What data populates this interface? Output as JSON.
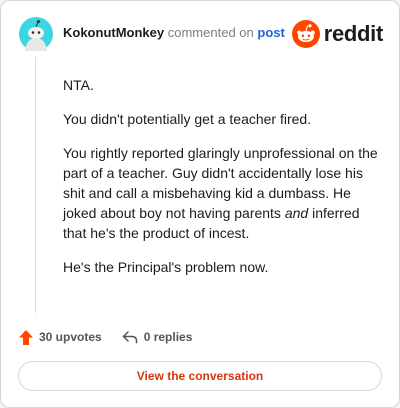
{
  "header": {
    "username": "KokonutMonkey",
    "action_text": "commented on",
    "post_link": "post",
    "logo_text": "reddit"
  },
  "comment": {
    "paragraphs": [
      "NTA.",
      "You didn't potentially get a teacher fired.",
      "You rightly reported glaringly unprofessional on the part of a teacher. Guy didn't accidentally lose his shit and call a misbehaving kid a dumbass. He joked about boy not having parents ",
      "He's the Principal's problem now."
    ],
    "p3_emphasis": "and",
    "p3_tail": " inferred that he's the product of incest."
  },
  "actions": {
    "upvotes": "30 upvotes",
    "replies": "0 replies"
  },
  "footer": {
    "view_label": "View the conversation"
  },
  "colors": {
    "brand": "#ff4500",
    "link": "#1f63d6",
    "cta": "#d4370f",
    "avatar_bg": "#3bd6e0"
  },
  "icons": {
    "avatar": "snoo-avatar-icon",
    "logo": "reddit-snoo-icon",
    "upvote": "upvote-arrow-icon",
    "reply": "reply-arrow-icon"
  }
}
